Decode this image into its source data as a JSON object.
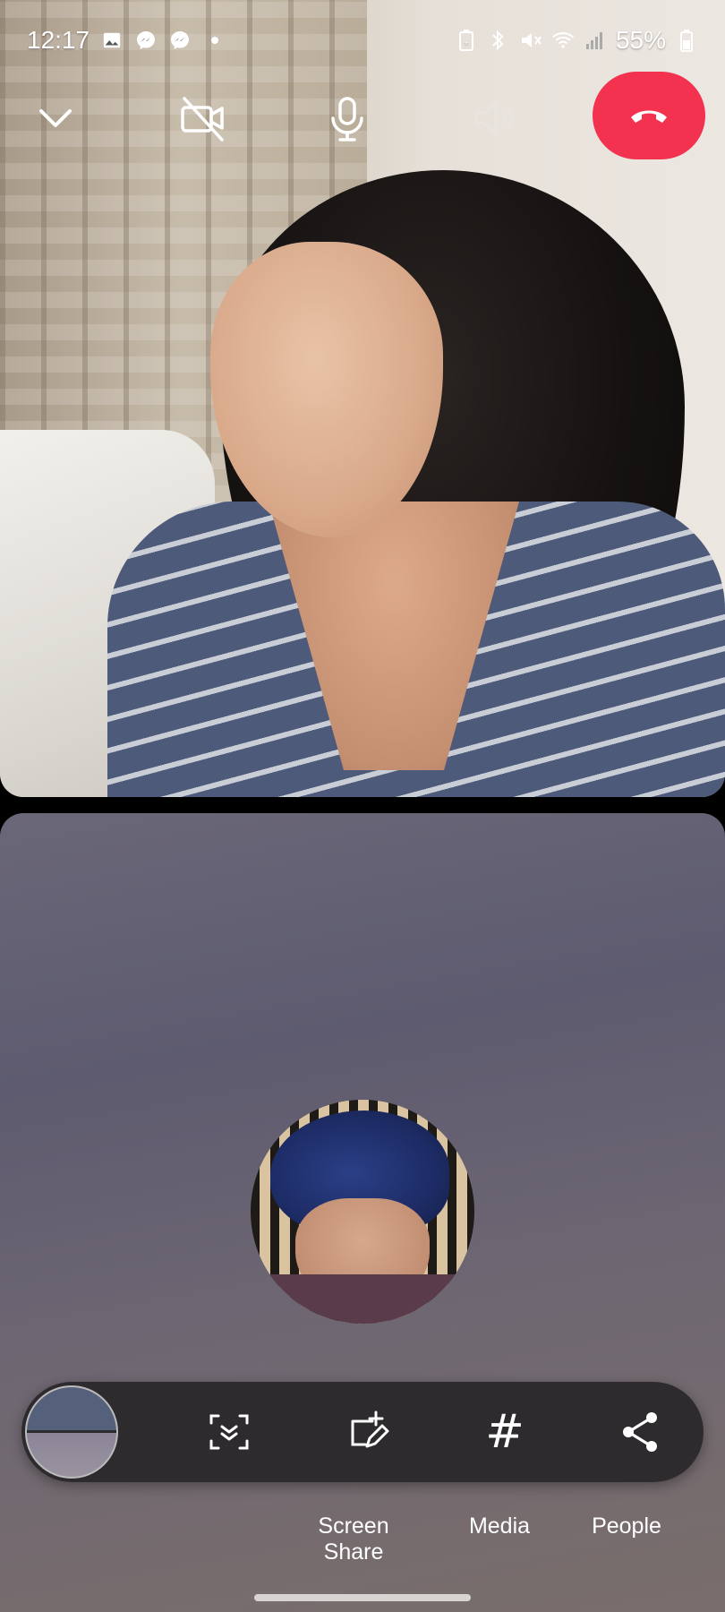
{
  "status_bar": {
    "time": "12:17",
    "battery": "55%",
    "icons": [
      "gallery-icon",
      "messenger-icon",
      "messenger-icon",
      "dot-icon",
      "battery-saver-icon",
      "bluetooth-icon",
      "mute-icon",
      "wifi-icon",
      "signal-icon",
      "battery-icon"
    ]
  },
  "call_controls": {
    "minimize": "chevron-down-icon",
    "camera": "camera-off-icon",
    "microphone": "microphone-icon",
    "speaker": "speaker-icon",
    "end_call": "end-call-icon",
    "end_call_color": "#f2324e"
  },
  "toolbar": {
    "items": [
      "screen-capture-icon",
      "smart-select-icon",
      "hashtag-icon",
      "share-icon"
    ],
    "hash_label": "#"
  },
  "bottom_labels": {
    "screen_share": "Screen Share",
    "media": "Media",
    "people": "People"
  }
}
